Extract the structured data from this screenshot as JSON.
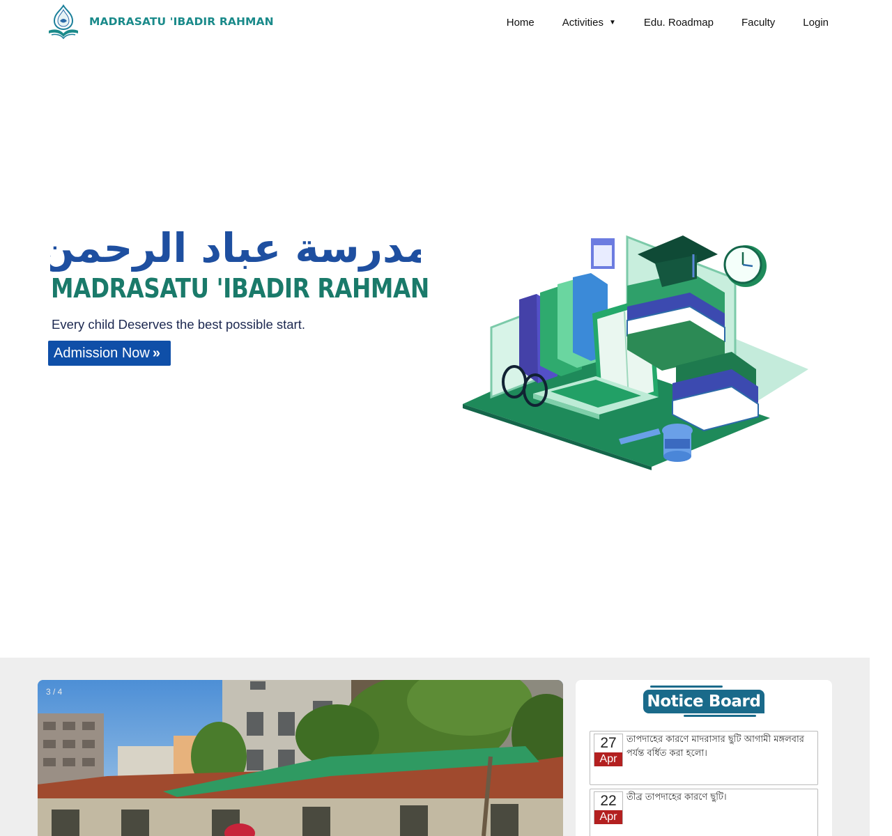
{
  "header": {
    "brand": "MADRASATU 'IBADIR RAHMAN",
    "logo_icon": "madrasa-logo-icon",
    "nav": [
      {
        "label": "Home"
      },
      {
        "label": "Activities",
        "has_dropdown": true,
        "caret": "▼"
      },
      {
        "label": "Edu. Roadmap"
      },
      {
        "label": "Faculty"
      },
      {
        "label": "Login"
      }
    ]
  },
  "hero": {
    "arabic_calligraphy": "مدرسة عباد الرحمن",
    "title": "MADRASATU  'IBADIR RAHMAN",
    "tagline": "Every child Deserves the best possible start.",
    "admission_button": "Admission Now",
    "admission_icon": "»",
    "illustration": "education-books-laptop-illustration"
  },
  "slider": {
    "counter": "3 / 4",
    "image": "madrasa-building-photo"
  },
  "notice_board": {
    "title": "Notice Board",
    "items": [
      {
        "day": "27",
        "month": "Apr",
        "text": "তাপদাহের কারণে মাদরাসার ছুটি আগামী মঙ্গলবার পর্যন্ত বর্ধিত করা হলো।"
      },
      {
        "day": "22",
        "month": "Apr",
        "text": "তীব্র তাপদাহের কারণে ছুটি।"
      }
    ]
  },
  "colors": {
    "brand_teal": "#1a8a8a",
    "button_blue": "#0f4fa8",
    "notice_title_bg": "#1a6a8a",
    "date_red": "#b32020",
    "section_bg": "#eeeeee"
  }
}
